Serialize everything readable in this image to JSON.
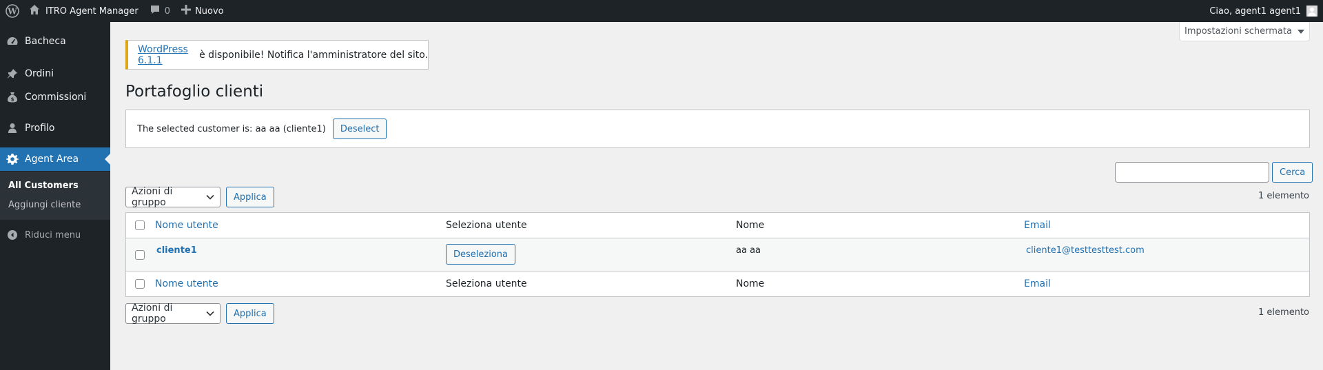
{
  "adminbar": {
    "site_name": "ITRO Agent Manager",
    "comments_count": "0",
    "new_label": "Nuovo",
    "greeting": "Ciao, agent1 agent1"
  },
  "sidebar": {
    "items": [
      {
        "label": "Bacheca",
        "icon": "dashboard-icon"
      },
      {
        "label": "Ordini",
        "icon": "pin-icon"
      },
      {
        "label": "Commissioni",
        "icon": "money-bag-icon"
      },
      {
        "label": "Profilo",
        "icon": "user-icon"
      },
      {
        "label": "Agent Area",
        "icon": "gear-icon",
        "current": true
      }
    ],
    "submenu": [
      {
        "label": "All Customers",
        "current": true
      },
      {
        "label": "Aggiungi cliente"
      }
    ],
    "collapse_label": "Riduci menu"
  },
  "screen_options": "Impostazioni schermata",
  "update_notice": {
    "link_text": "WordPress 6.1.1",
    "text": " è disponibile! Notifica l'amministratore del sito."
  },
  "page_title": "Portafoglio clienti",
  "selected_notice": {
    "text": "The selected customer is: aa aa (cliente1)",
    "button": "Deselect"
  },
  "search": {
    "value": "",
    "button": "Cerca"
  },
  "bulk_actions": {
    "select_label": "Azioni di gruppo",
    "apply_label": "Applica"
  },
  "item_count": "1 elemento",
  "table": {
    "columns": [
      "Nome utente",
      "Seleziona utente",
      "Nome",
      "Email"
    ],
    "rows": [
      {
        "username": "cliente1",
        "select_button": "Deseleziona",
        "name": "aa aa",
        "email": "cliente1@testtesttest.com"
      }
    ]
  },
  "colors": {
    "accent": "#2271b1",
    "adminbar_bg": "#1d2327",
    "notice_warning": "#dba617"
  }
}
